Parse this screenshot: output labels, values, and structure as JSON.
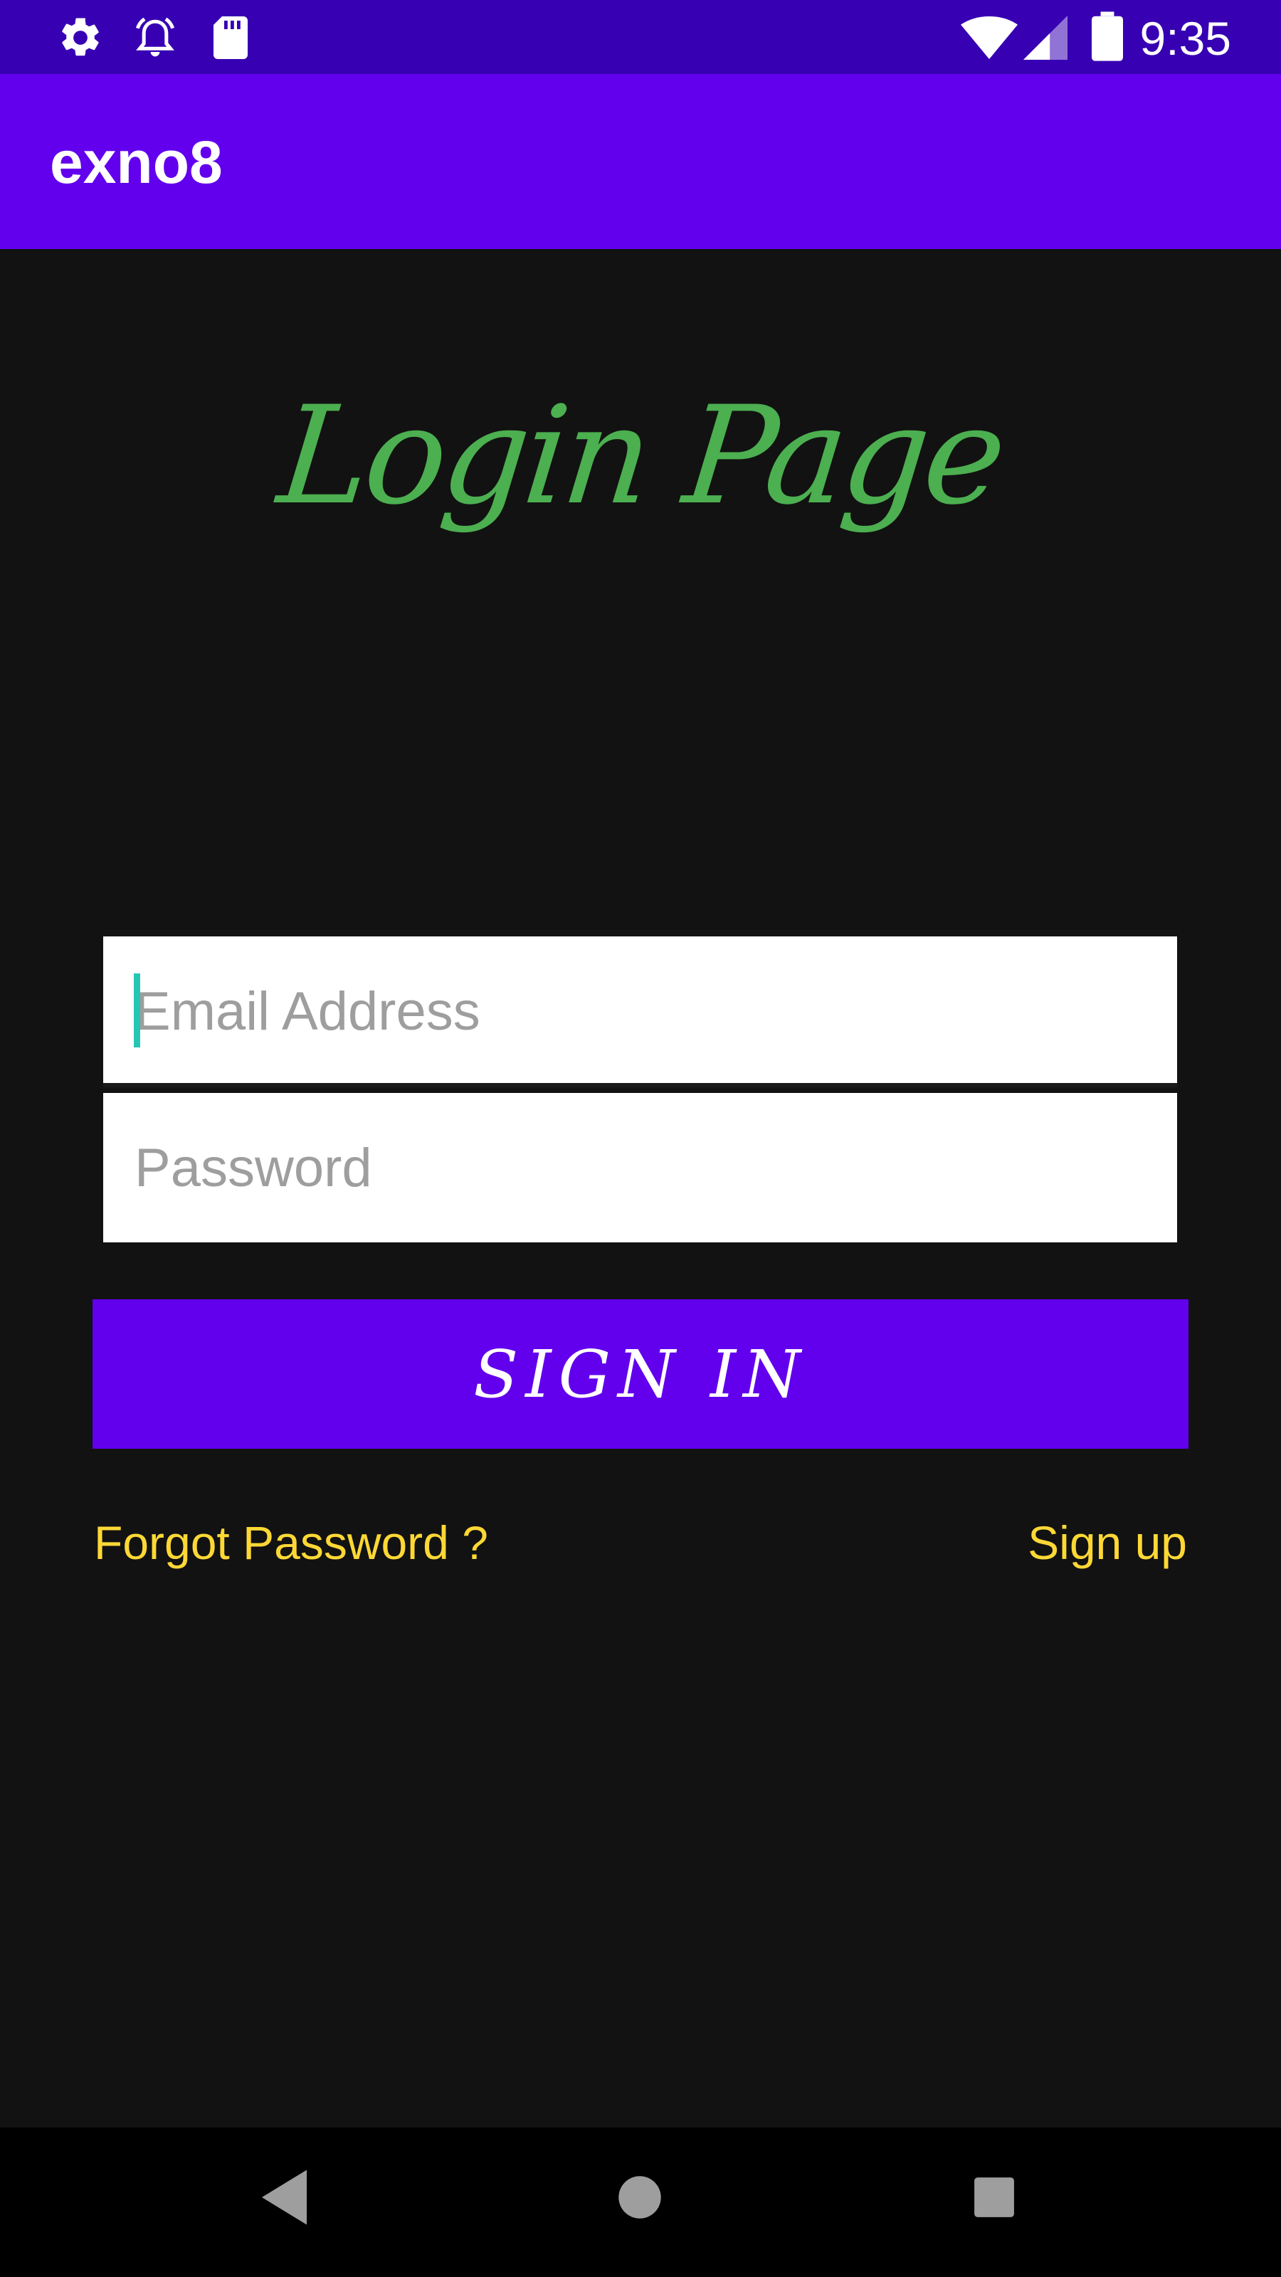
{
  "status_bar": {
    "time": "9:35",
    "icons": [
      "gear-icon",
      "alarm-icon",
      "sd-card-icon",
      "wifi-icon",
      "signal-icon",
      "battery-icon"
    ]
  },
  "app_bar": {
    "title": "exno8"
  },
  "login": {
    "heading": "Login Page",
    "email": {
      "placeholder": "Email Address",
      "value": ""
    },
    "password": {
      "placeholder": "Password",
      "value": ""
    },
    "signin_label": "SIGN IN",
    "forgot_label": "Forgot Password ?",
    "signup_label": "Sign up"
  },
  "nav_bar": {
    "buttons": [
      "back-icon",
      "home-icon",
      "recents-icon"
    ]
  },
  "colors": {
    "status_bar": "#3700b3",
    "app_bar": "#6200ee",
    "background": "#121212",
    "heading": "#4caf50",
    "link": "#fdd835",
    "button": "#6200ee"
  }
}
